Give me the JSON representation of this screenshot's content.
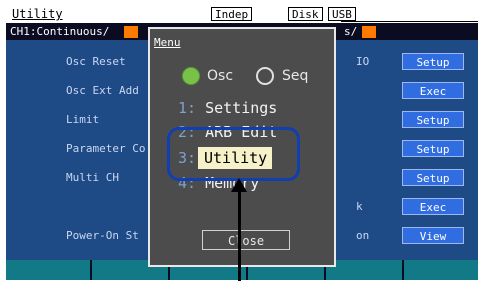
{
  "topbar": {
    "title": "Utility",
    "indep": "Indep",
    "disk": "Disk",
    "usb": "USB"
  },
  "chbar": {
    "left_text": "CH1:Continuous/",
    "right_text": "s/"
  },
  "main": {
    "rows": [
      {
        "label": "Osc Reset"
      },
      {
        "label": "Osc Ext Add"
      },
      {
        "label": "Limit"
      },
      {
        "label": "Parameter Co"
      },
      {
        "label": "Multi CH"
      },
      {
        "label": ""
      },
      {
        "label": "Power-On St"
      }
    ],
    "right_labels": [
      "IO",
      "k",
      "on"
    ],
    "buttons": [
      "Setup",
      "Exec",
      "Setup",
      "Setup",
      "Setup",
      "Exec",
      "View"
    ]
  },
  "menu": {
    "title": "Menu",
    "radio_osc": "Osc",
    "radio_seq": "Seq",
    "items": [
      {
        "num": "1:",
        "label": "Settings"
      },
      {
        "num": "2:",
        "label": "ARB Edit"
      },
      {
        "num": "3:",
        "label": "Utility"
      },
      {
        "num": "4:",
        "label": "Memory"
      }
    ],
    "close_label": "Close"
  },
  "colors": {
    "panel": "#1e4a86",
    "button": "#2f6de0",
    "highlight": "#f6f1c9",
    "callout": "#0f3fb0",
    "accent_orange": "#ff7a00",
    "radio_on": "#79c24a"
  }
}
